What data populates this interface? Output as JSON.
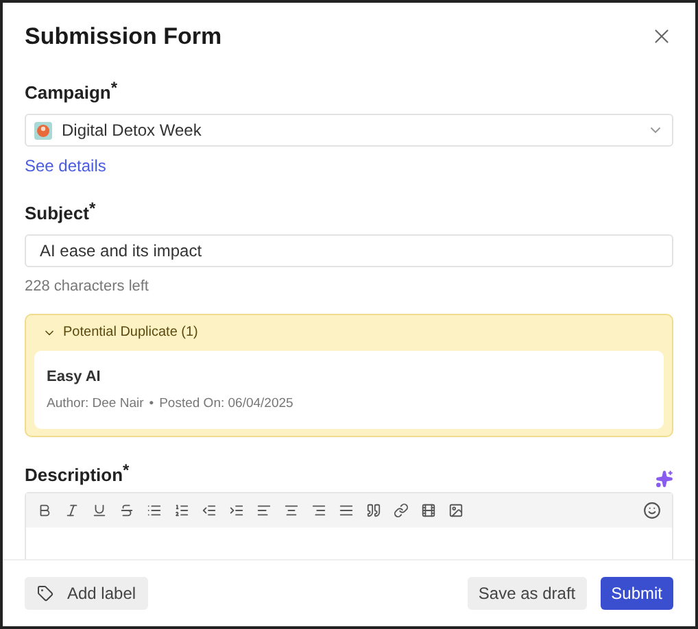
{
  "dialog": {
    "title": "Submission Form"
  },
  "campaign": {
    "label": "Campaign",
    "required_mark": "*",
    "value": "Digital Detox Week",
    "link": "See details"
  },
  "subject": {
    "label": "Subject",
    "required_mark": "*",
    "value": "AI ease and its impact",
    "hint": "228 characters left"
  },
  "duplicates": {
    "title": "Potential Duplicate (1)",
    "expanded": true,
    "items": [
      {
        "title": "Easy AI",
        "author": "Author: Dee Nair",
        "separator": "•",
        "posted": "Posted On: 06/04/2025"
      }
    ]
  },
  "description": {
    "label": "Description",
    "required_mark": "*"
  },
  "footer": {
    "add_label": "Add label",
    "save_draft": "Save as draft",
    "submit": "Submit"
  }
}
